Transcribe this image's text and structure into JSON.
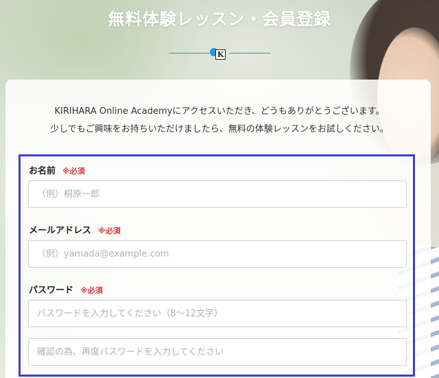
{
  "header": {
    "title": "無料体験レッスン・会員登録",
    "logo_letter": "K"
  },
  "intro": {
    "line1": "KIRIHARA Online Academyにアクセスいただき、どうもありがとうございます。",
    "line2": "少しでもご興味をお持ちいただけましたら、無料の体験レッスンをお試しください。"
  },
  "form": {
    "name": {
      "label": "お名前",
      "required": "※必須",
      "placeholder": "（例）桐原一郎"
    },
    "email": {
      "label": "メールアドレス",
      "required": "※必須",
      "placeholder": "（例）yamada@example.com"
    },
    "password": {
      "label": "パスワード",
      "required": "※必須",
      "placeholder": "パスワードを入力してください（8〜12文字）",
      "confirm_placeholder": "確認の為、再度パスワードを入力してください"
    }
  },
  "colors": {
    "highlight_border": "#3a41c6",
    "required": "#d83a3a",
    "accent": "#1f9bd7"
  }
}
